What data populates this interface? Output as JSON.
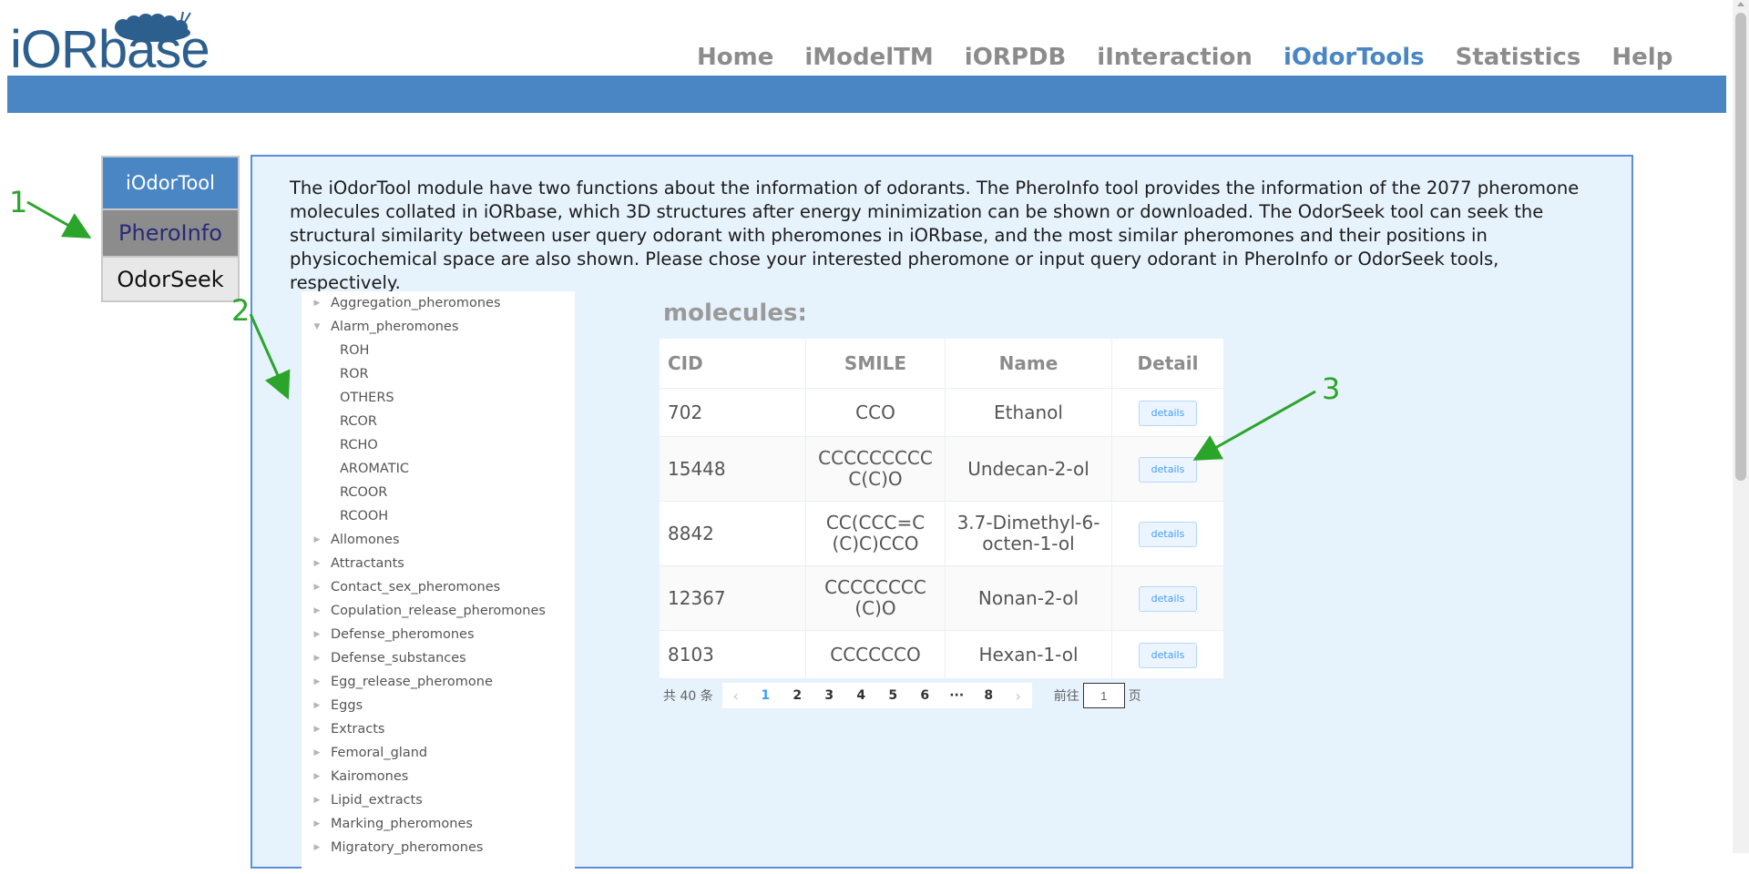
{
  "header": {
    "logo_text": "iORbase",
    "nav": [
      {
        "label": "Home"
      },
      {
        "label": "iModelTM"
      },
      {
        "label": "iORPDB"
      },
      {
        "label": "iInteraction"
      },
      {
        "label": "iOdorTools"
      },
      {
        "label": "Statistics"
      },
      {
        "label": "Help"
      }
    ],
    "active_nav": "iOdorTools",
    "accent_color": "#4a86c4"
  },
  "tool_menu": {
    "title": "iOdorTool",
    "items": [
      {
        "label": "PheroInfo"
      },
      {
        "label": "OdorSeek"
      }
    ]
  },
  "intro_text": "The iOdorTool module have two functions about the information of odorants. The PheroInfo tool provides the information of the 2077 pheromone molecules collated in iORbase, which 3D structures after energy minimization can be shown or downloaded. The OdorSeek tool can seek the structural similarity between user query odorant with pheromones in iORbase, and the most similar pheromones and their positions in physicochemical space are also shown. Please chose your interested pheromone or input query odorant in PheroInfo or OdorSeek tools, respectively.",
  "tree": [
    {
      "label": "Aggregation_pheromones"
    },
    {
      "label": "Alarm_pheromones"
    },
    {
      "label": "ROH"
    },
    {
      "label": "ROR"
    },
    {
      "label": "OTHERS"
    },
    {
      "label": "RCOR"
    },
    {
      "label": "RCHO"
    },
    {
      "label": "AROMATIC"
    },
    {
      "label": "RCOOR"
    },
    {
      "label": "RCOOH"
    },
    {
      "label": "Allomones"
    },
    {
      "label": "Attractants"
    },
    {
      "label": "Contact_sex_pheromones"
    },
    {
      "label": "Copulation_release_pheromones"
    },
    {
      "label": "Defense_pheromones"
    },
    {
      "label": "Defense_substances"
    },
    {
      "label": "Egg_release_pheromone"
    },
    {
      "label": "Eggs"
    },
    {
      "label": "Extracts"
    },
    {
      "label": "Femoral_gland"
    },
    {
      "label": "Kairomones"
    },
    {
      "label": "Lipid_extracts"
    },
    {
      "label": "Marking_pheromones"
    },
    {
      "label": "Migratory_pheromones"
    }
  ],
  "molecules": {
    "title": "molecules:",
    "columns": [
      "CID",
      "SMILE",
      "Name",
      "Detail"
    ],
    "rows": [
      {
        "cid": "702",
        "smile": "CCO",
        "name": "Ethanol",
        "detail": "details"
      },
      {
        "cid": "15448",
        "smile": "CCCCCCCCCC(C)O",
        "name": "Undecan-2-ol",
        "detail": "details"
      },
      {
        "cid": "8842",
        "smile": "CC(CCC=C(C)C)CCO",
        "name": "3.7-Dimethyl-6-octen-1-ol",
        "detail": "details"
      },
      {
        "cid": "12367",
        "smile": "CCCCCCCC(C)O",
        "name": "Nonan-2-ol",
        "detail": "details"
      },
      {
        "cid": "8103",
        "smile": "CCCCCCO",
        "name": "Hexan-1-ol",
        "detail": "details"
      }
    ]
  },
  "pagination": {
    "total": "共 40 条",
    "pages": [
      "1",
      "2",
      "3",
      "4",
      "5",
      "6",
      "···",
      "8"
    ],
    "current": "1",
    "goto_prefix": "前往",
    "goto_value": "1",
    "goto_suffix": "页"
  },
  "annotations": [
    "1",
    "2",
    "3"
  ]
}
